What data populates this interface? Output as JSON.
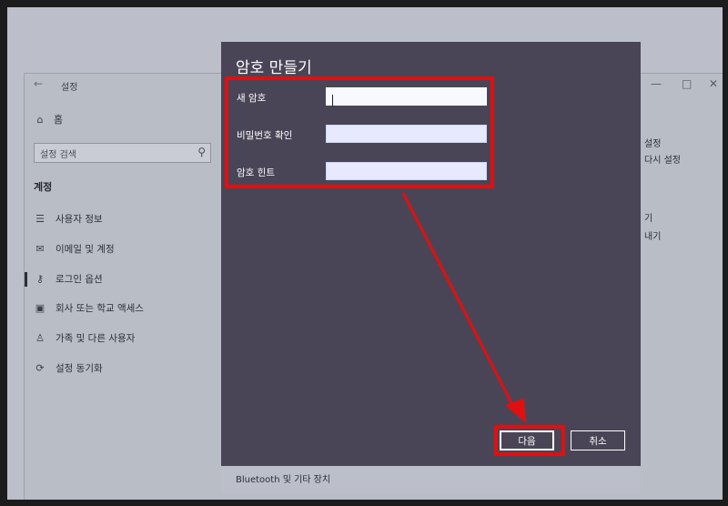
{
  "settings_window": {
    "title": "설정",
    "back_glyph": "←",
    "controls": [
      "—",
      "□",
      "✕"
    ],
    "home_label": "홈",
    "search_placeholder": "설정 검색",
    "section_title": "계정",
    "nav_items": [
      {
        "label": "사용자 정보",
        "icon": "person-card-icon"
      },
      {
        "label": "이메일 및 계정",
        "icon": "mail-icon"
      },
      {
        "label": "로그인 옵션",
        "icon": "key-icon",
        "active": true
      },
      {
        "label": "회사 또는 학교 액세스",
        "icon": "briefcase-icon"
      },
      {
        "label": "가족 및 다른 사용자",
        "icon": "person-add-icon"
      },
      {
        "label": "설정 동기화",
        "icon": "sync-icon"
      }
    ],
    "right_fragments": [
      "설정",
      "다시 설정",
      "기",
      "내기"
    ]
  },
  "dialog": {
    "title": "암호 만들기",
    "fields": [
      {
        "label": "새 암호",
        "value": ""
      },
      {
        "label": "비밀번호 확인",
        "value": ""
      },
      {
        "label": "암호 힌트",
        "value": ""
      }
    ],
    "next_label": "다음",
    "cancel_label": "취소",
    "footer_text": "Bluetooth 및 기타 장치"
  },
  "colors": {
    "dialog_bg": "#4a4556",
    "highlight": "#e01010",
    "settings_bg": "#bcbfca"
  }
}
